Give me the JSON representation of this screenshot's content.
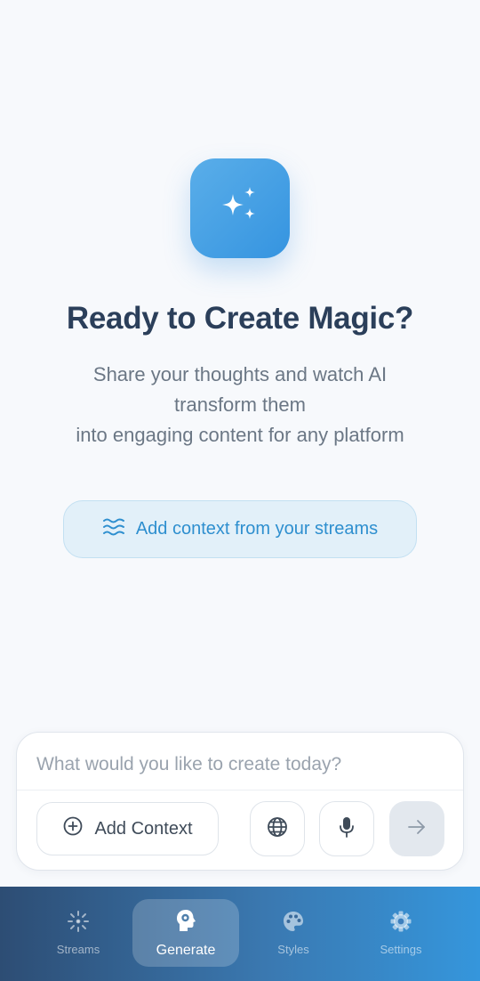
{
  "hero": {
    "icon": "sparkles-icon",
    "title": "Ready to Create Magic?",
    "subtitle_lines": [
      "Share your thoughts and watch AI",
      "transform them",
      "into engaging content for any platform"
    ]
  },
  "context_button": {
    "icon": "waves-icon",
    "label": "Add context from your streams"
  },
  "composer": {
    "placeholder": "What would you like to create today?",
    "value": "",
    "add_context_label": "Add Context",
    "add_context_icon": "plus-circle-icon",
    "globe_icon": "globe-icon",
    "mic_icon": "microphone-icon",
    "send_icon": "arrow-right-icon"
  },
  "tabs": [
    {
      "label": "Streams",
      "icon": "streams-icon",
      "active": false
    },
    {
      "label": "Generate",
      "icon": "brain-gear-icon",
      "active": true
    },
    {
      "label": "Styles",
      "icon": "palette-icon",
      "active": false
    },
    {
      "label": "Settings",
      "icon": "gear-icon",
      "active": false
    }
  ],
  "colors": {
    "accent": "#3594e0",
    "title": "#2b3f5a",
    "tabbar_start": "#2d4d74",
    "tabbar_end": "#3596dc"
  }
}
